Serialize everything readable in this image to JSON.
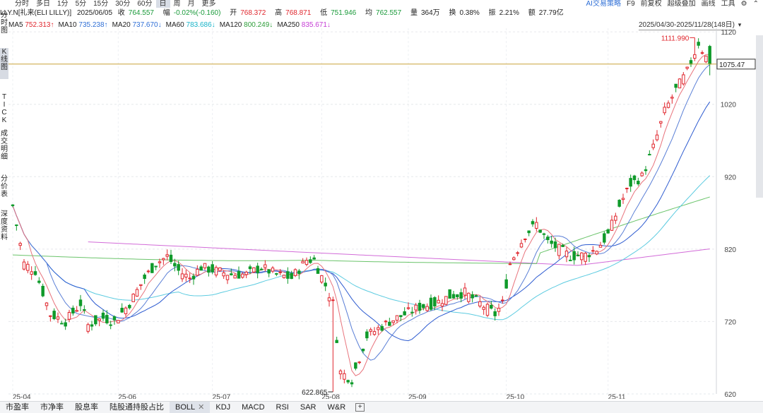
{
  "period_tabs": [
    "分时",
    "多日",
    "1分",
    "5分",
    "15分",
    "30分",
    "60分",
    "日",
    "周",
    "月",
    "更多"
  ],
  "active_period": "日",
  "right_tools": {
    "ai": "AI交易策略",
    "f9": "F9",
    "fq": "前复权",
    "overlay": "超级叠加",
    "draw": "画线",
    "tools": "工具"
  },
  "side_tabs": [
    {
      "label": "分\n时\n图"
    },
    {
      "label": "K\n线\n图"
    },
    {
      "label": "T\nI\nC\nK"
    },
    {
      "label": "成\n交\n明\n细"
    },
    {
      "label": "分\n价\n表"
    },
    {
      "label": "深\n度\n资\n料"
    }
  ],
  "info": {
    "ticker": "LLY.N[礼来(ELI LILLY)]",
    "date": "2025/06/05",
    "close_label": "收",
    "close": "764.557",
    "change_label": "幅",
    "change": "-0.02%(-0.160)",
    "open_label": "开",
    "open": "768.372",
    "high_label": "高",
    "high": "768.871",
    "low_label": "低",
    "low": "751.946",
    "avg_label": "均",
    "avg": "762.557",
    "vol_label": "量",
    "vol": "364万",
    "turnover_label": "换",
    "turnover": "0.38%",
    "amp_label": "振",
    "amp": "2.21%",
    "amount_label": "额",
    "amount": "27.79亿"
  },
  "ma": [
    {
      "name": "MA5",
      "value": "752.313",
      "arrow": "↑",
      "color": "#e0262d"
    },
    {
      "name": "MA10",
      "value": "735.238",
      "arrow": "↑",
      "color": "#2f6fd6"
    },
    {
      "name": "MA20",
      "value": "737.670",
      "arrow": "↓",
      "color": "#2f6fd6"
    },
    {
      "name": "MA60",
      "value": "783.686",
      "arrow": "↓",
      "color": "#18b3c8"
    },
    {
      "name": "MA120",
      "value": "800.249",
      "arrow": "↓",
      "color": "#2e9e3a"
    },
    {
      "name": "MA250",
      "value": "835.671",
      "arrow": "↓",
      "color": "#c43bd4"
    }
  ],
  "date_range": "2025/04/30-2025/11/28(148日)",
  "colors": {
    "up": "#e0262d",
    "down": "#0f9a2a",
    "ma5": "#e8737c",
    "ma10": "#5a7fd6",
    "ma20": "#2d5bd0",
    "ma60": "#5ccbe0",
    "ma120": "#6bc46b",
    "ma250": "#d26bd8",
    "current_line": "#c9a23a"
  },
  "chart_data": {
    "type": "candlestick",
    "ylim": [
      620,
      1125
    ],
    "y_ticks": [
      620,
      720,
      820,
      920,
      1020,
      1120
    ],
    "x_labels": [
      "25-04",
      "25-06",
      "25-07",
      "25-08",
      "25-09",
      "25-10",
      "25-11"
    ],
    "x_label_index": [
      0,
      28,
      53,
      82,
      105,
      131,
      158
    ],
    "current_price": "1075.47",
    "current_value": 1075.47,
    "max_label": "1111.990",
    "max_value": 1111.99,
    "max_index": 181,
    "min_label": "622.865",
    "min_value": 622.865,
    "min_index": 85,
    "num_candles": 186
  },
  "bottom_tabs": [
    "市盈率",
    "市净率",
    "股息率",
    "陆股通持股占比",
    "BOLL",
    "KDJ",
    "MACD",
    "RSI",
    "SAR",
    "W&R"
  ],
  "active_bottom": "BOLL",
  "bottom_close": "✕",
  "bottom_add": "+"
}
